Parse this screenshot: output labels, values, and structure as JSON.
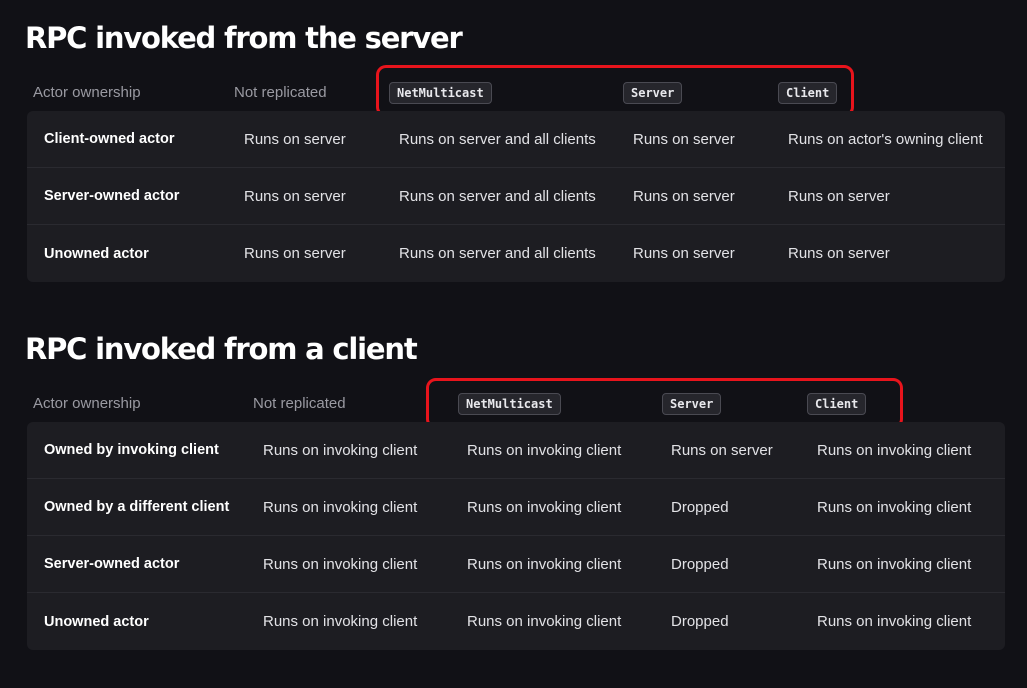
{
  "section1": {
    "title": "RPC invoked from the server",
    "headers": [
      "Actor ownership",
      "Not replicated",
      "NetMulticast",
      "Server",
      "Client"
    ],
    "rows": [
      [
        "Client-owned actor",
        "Runs on server",
        "Runs on server and all clients",
        "Runs on server",
        "Runs on actor's owning client"
      ],
      [
        "Server-owned actor",
        "Runs on server",
        "Runs on server and all clients",
        "Runs on server",
        "Runs on server"
      ],
      [
        "Unowned actor",
        "Runs on server",
        "Runs on server and all clients",
        "Runs on server",
        "Runs on server"
      ]
    ]
  },
  "section2": {
    "title": "RPC invoked from a client",
    "headers": [
      "Actor ownership",
      "Not replicated",
      "NetMulticast",
      "Server",
      "Client"
    ],
    "rows": [
      [
        "Owned by invoking client",
        "Runs on invoking client",
        "Runs on invoking client",
        "Runs on server",
        "Runs on invoking client"
      ],
      [
        "Owned by a different client",
        "Runs on invoking client",
        "Runs on invoking client",
        "Dropped",
        "Runs on invoking client"
      ],
      [
        "Server-owned actor",
        "Runs on invoking client",
        "Runs on invoking client",
        "Dropped",
        "Runs on invoking client"
      ],
      [
        "Unowned actor",
        "Runs on invoking client",
        "Runs on invoking client",
        "Dropped",
        "Runs on invoking client"
      ]
    ]
  },
  "colors": {
    "background": "#111116",
    "table": "#1d1d22",
    "highlight": "#e8141c"
  }
}
